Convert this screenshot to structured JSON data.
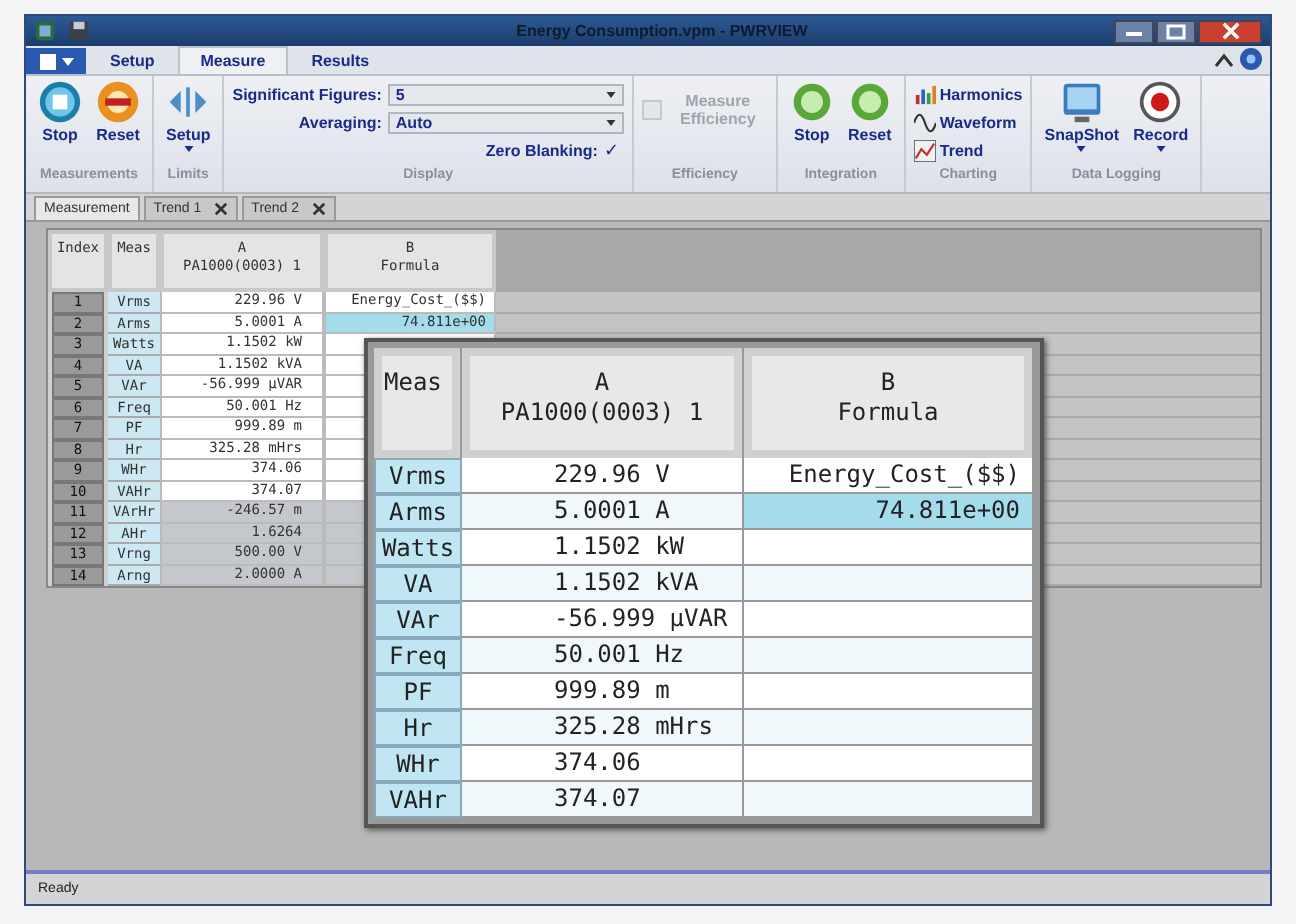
{
  "window": {
    "title": "Energy Consumption.vpm - PWRVIEW"
  },
  "ribbon_tabs": [
    {
      "label": "Setup",
      "selected": false
    },
    {
      "label": "Measure",
      "selected": true
    },
    {
      "label": "Results",
      "selected": false
    }
  ],
  "ribbon_groups": [
    {
      "label": "Measurements",
      "items": [
        {
          "kind": "large",
          "label": "Stop"
        },
        {
          "kind": "large",
          "label": "Reset"
        }
      ]
    },
    {
      "label": "Limits",
      "items": [
        {
          "kind": "large",
          "label": "Setup",
          "dropdown": true
        }
      ]
    },
    {
      "label": "Display",
      "items": [
        {
          "kind": "combo",
          "label": "Significant Figures:",
          "value": "5"
        },
        {
          "kind": "combo",
          "label": "Averaging:",
          "value": "Auto"
        },
        {
          "kind": "check",
          "label": "Zero Blanking:",
          "mark": "✓",
          "disabled": false
        }
      ]
    },
    {
      "label": "Efficiency",
      "items": [
        {
          "kind": "checkbox",
          "label": "Measure Efficiency",
          "checked": false,
          "disabled": true
        }
      ]
    },
    {
      "label": "Integration",
      "items": [
        {
          "kind": "large",
          "label": "Stop"
        },
        {
          "kind": "large",
          "label": "Reset"
        }
      ]
    },
    {
      "label": "Charting",
      "items": [
        {
          "kind": "small",
          "label": "Harmonics"
        },
        {
          "kind": "small",
          "label": "Waveform"
        },
        {
          "kind": "small",
          "label": "Trend"
        }
      ]
    },
    {
      "label": "Data Logging",
      "items": [
        {
          "kind": "large",
          "label": "SnapShot",
          "dropdown": true
        },
        {
          "kind": "large",
          "label": "Record",
          "dropdown": true
        }
      ]
    }
  ],
  "doc_tabs": [
    {
      "label": "Measurement",
      "selected": true,
      "closable": false
    },
    {
      "label": "Trend 1",
      "selected": false,
      "closable": true
    },
    {
      "label": "Trend 2",
      "selected": false,
      "closable": true
    }
  ],
  "table": {
    "columns": [
      {
        "label": "Index"
      },
      {
        "label": "Meas"
      },
      {
        "label": "A",
        "sublabel": "PA1000(0003) 1"
      },
      {
        "label": "B",
        "sublabel": "Formula"
      }
    ],
    "rows": [
      {
        "index": "1",
        "meas": "Vrms",
        "a": "229.96 V",
        "b": "Energy_Cost_($$)",
        "selected": false,
        "shaded": false
      },
      {
        "index": "2",
        "meas": "Arms",
        "a": "5.0001 A",
        "b": "74.811e+00",
        "selected": true,
        "shaded": false
      },
      {
        "index": "3",
        "meas": "Watts",
        "a": "1.1502 kW",
        "selected": false,
        "shaded": false
      },
      {
        "index": "4",
        "meas": "VA",
        "a": "1.1502 kVA",
        "selected": false,
        "shaded": false
      },
      {
        "index": "5",
        "meas": "VAr",
        "a": "-56.999 μVAR",
        "selected": false,
        "shaded": false
      },
      {
        "index": "6",
        "meas": "Freq",
        "a": "50.001 Hz",
        "selected": false,
        "shaded": false
      },
      {
        "index": "7",
        "meas": "PF",
        "a": "999.89 m",
        "selected": false,
        "shaded": false
      },
      {
        "index": "8",
        "meas": "Hr",
        "a": "325.28 mHrs",
        "selected": false,
        "shaded": false
      },
      {
        "index": "9",
        "meas": "WHr",
        "a": "374.06",
        "selected": false,
        "shaded": false
      },
      {
        "index": "10",
        "meas": "VAHr",
        "a": "374.07",
        "selected": false,
        "shaded": false
      },
      {
        "index": "11",
        "meas": "VArHr",
        "a": "-246.57 m",
        "selected": false,
        "shaded": true
      },
      {
        "index": "12",
        "meas": "AHr",
        "a": "1.6264",
        "selected": false,
        "shaded": true
      },
      {
        "index": "13",
        "meas": "Vrng",
        "a": "500.00 V",
        "selected": false,
        "shaded": true
      },
      {
        "index": "14",
        "meas": "Arng",
        "a": "2.0000 A",
        "selected": false,
        "shaded": true
      }
    ]
  },
  "magnified_table": {
    "columns": [
      {
        "label": "Meas"
      },
      {
        "label": "A",
        "sublabel": "PA1000(0003) 1"
      },
      {
        "label": "B",
        "sublabel": "Formula"
      }
    ],
    "rows": [
      {
        "meas": "Vrms",
        "a": "229.96 V",
        "b": "Energy_Cost_($$)",
        "selected": false
      },
      {
        "meas": "Arms",
        "a": "5.0001 A",
        "b": "74.811e+00",
        "selected": true
      },
      {
        "meas": "Watts",
        "a": "1.1502 kW",
        "selected": false
      },
      {
        "meas": "VA",
        "a": "1.1502 kVA",
        "selected": false
      },
      {
        "meas": "VAr",
        "a": "-56.999 μVAR",
        "selected": false
      },
      {
        "meas": "Freq",
        "a": "50.001 Hz",
        "selected": false
      },
      {
        "meas": "PF",
        "a": "999.89 m",
        "selected": false
      },
      {
        "meas": "Hr",
        "a": "325.28 mHrs",
        "selected": false
      },
      {
        "meas": "WHr",
        "a": "374.06",
        "selected": false
      },
      {
        "meas": "VAHr",
        "a": "374.07",
        "selected": false
      }
    ]
  },
  "status_bar": {
    "text": "Ready"
  }
}
